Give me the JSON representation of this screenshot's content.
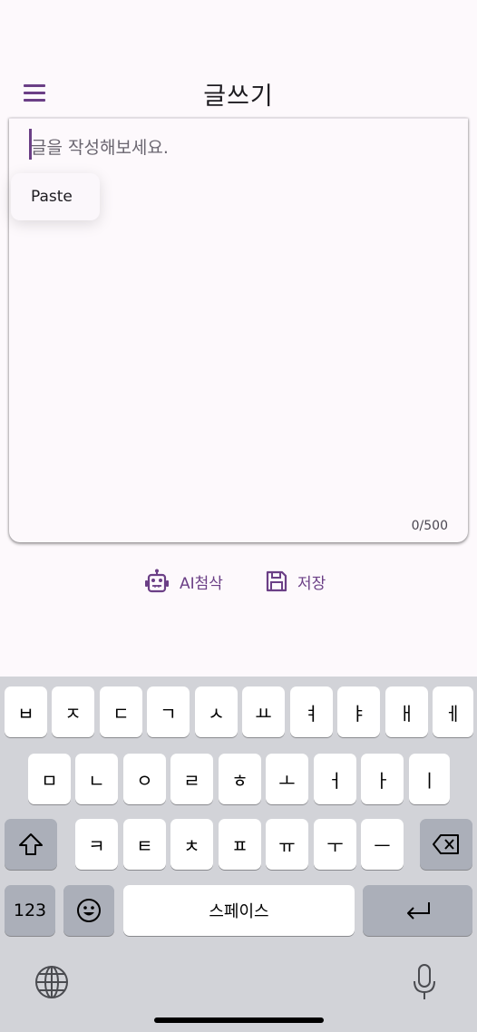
{
  "header": {
    "title": "글쓰기",
    "menu_icon": "hamburger-menu-icon"
  },
  "editor": {
    "placeholder": "글을 작성해보세요.",
    "value": "",
    "counter": "0/500",
    "context_menu": {
      "paste_label": "Paste"
    }
  },
  "actions": {
    "ai_label": "AI첨삭",
    "ai_icon": "robot-icon",
    "save_label": "저장",
    "save_icon": "floppy-disk-icon"
  },
  "keyboard": {
    "row1": [
      "ㅂ",
      "ㅈ",
      "ㄷ",
      "ㄱ",
      "ㅅ",
      "ㅛ",
      "ㅕ",
      "ㅑ",
      "ㅐ",
      "ㅔ"
    ],
    "row2": [
      "ㅁ",
      "ㄴ",
      "ㅇ",
      "ㄹ",
      "ㅎ",
      "ㅗ",
      "ㅓ",
      "ㅏ",
      "ㅣ"
    ],
    "row3": [
      "ㅋ",
      "ㅌ",
      "ㅊ",
      "ㅍ",
      "ㅠ",
      "ㅜ",
      "ㅡ"
    ],
    "numbers_label": "123",
    "space_label": "스페이스",
    "shift_icon": "shift-icon",
    "backspace_icon": "backspace-icon",
    "emoji_icon": "emoji-icon",
    "return_icon": "return-icon",
    "globe_icon": "globe-icon",
    "mic_icon": "microphone-icon"
  },
  "colors": {
    "accent": "#6b3f86",
    "background": "#fdf9fc",
    "keyboard_bg": "#d2d3d8"
  }
}
